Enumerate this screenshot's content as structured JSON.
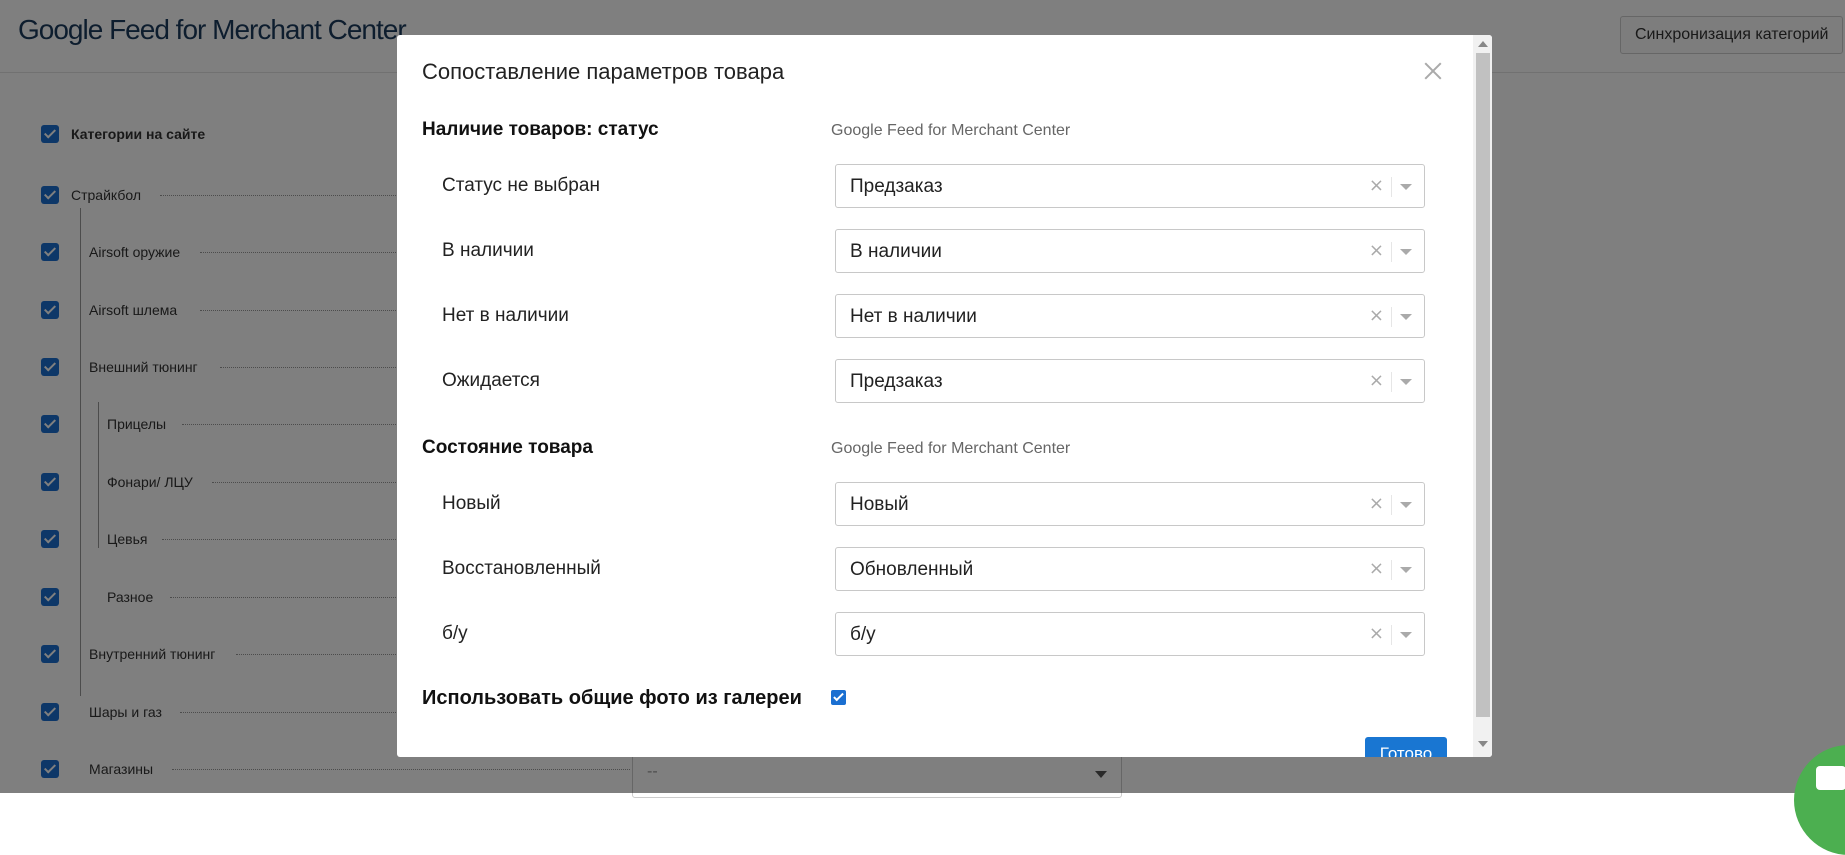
{
  "page": {
    "title": "Google Feed for Merchant Center",
    "sync_button": "Синхронизация категорий"
  },
  "categories": {
    "header": "Категории на сайте",
    "items": [
      "Страйкбол",
      "Airsoft оружие",
      "Airsoft шлема",
      "Внешний тюнинг",
      "Прицелы",
      "Фонари/ ЛЦУ",
      "Цевья",
      "Разное",
      "Внутренний тюнинг",
      "Шары и газ",
      "Магазины"
    ],
    "background_select_value": "--"
  },
  "modal": {
    "title": "Сопоставление параметров товара",
    "availability": {
      "title": "Наличие товаров: статус",
      "subtitle": "Google Feed for Merchant Center",
      "rows": [
        {
          "label": "Статус не выбран",
          "value": "Предзаказ"
        },
        {
          "label": "В наличии",
          "value": "В наличии"
        },
        {
          "label": "Нет в наличии",
          "value": "Нет в наличии"
        },
        {
          "label": "Ожидается",
          "value": "Предзаказ"
        }
      ]
    },
    "condition": {
      "title": "Состояние товара",
      "subtitle": "Google Feed for Merchant Center",
      "rows": [
        {
          "label": "Новый",
          "value": "Новый"
        },
        {
          "label": "Восстановленный",
          "value": "Обновленный"
        },
        {
          "label": "б/у",
          "value": "б/у"
        }
      ]
    },
    "gallery": {
      "label": "Использовать общие фото из галереи",
      "checked": true
    },
    "done_button": "Готово",
    "clear_glyph": "×"
  },
  "colors": {
    "accent": "#1976d2",
    "checkbox": "#1a6fd1",
    "chat": "#4caf50"
  }
}
